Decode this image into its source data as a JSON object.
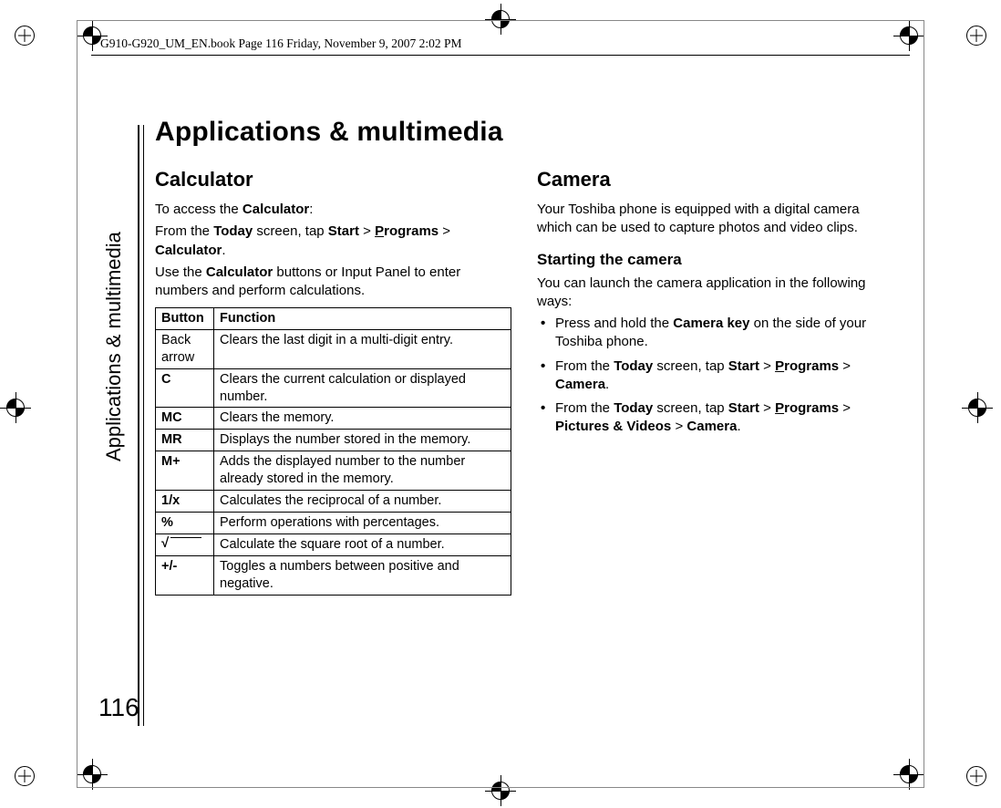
{
  "header": "G910-G920_UM_EN.book  Page 116  Friday, November 9, 2007  2:02 PM",
  "sidebar_label": "Applications & multimedia",
  "page_number": "116",
  "chapter_title": "Applications & multimedia",
  "left": {
    "h1": "Calculator",
    "p1_pre": "To access the ",
    "p1_b": "Calculator",
    "p1_post": ":",
    "p2_a": "From the ",
    "p2_b": "Today",
    "p2_c": " screen, tap ",
    "p2_d": "Start",
    "p2_e": " > ",
    "p2_f_u": "P",
    "p2_f_rest": "rograms",
    "p2_g": " > ",
    "p2_h": "Calculator",
    "p2_i": ".",
    "p3_a": "Use the ",
    "p3_b": "Calculator",
    "p3_c": " buttons or Input Panel to enter numbers and perform calculations.",
    "table": {
      "h_button": "Button",
      "h_function": "Function",
      "rows": [
        {
          "btn": "Back arrow",
          "plain": true,
          "fn": "Clears the last digit in a multi-digit entry."
        },
        {
          "btn": "C",
          "fn": "Clears the current calculation or displayed number."
        },
        {
          "btn": "MC",
          "fn": "Clears the memory."
        },
        {
          "btn": "MR",
          "fn": "Displays the number stored in the memory."
        },
        {
          "btn": "M+",
          "fn": "Adds the displayed number to the number already stored in the memory."
        },
        {
          "btn": "1/x",
          "fn": "Calculates the reciprocal of a number."
        },
        {
          "btn": "%",
          "fn": "Perform operations with percentages."
        },
        {
          "btn": "__SQRT__",
          "fn": "Calculate the square root of a number."
        },
        {
          "btn": "+/-",
          "fn": "Toggles a numbers between positive and negative."
        }
      ]
    }
  },
  "right": {
    "h1": "Camera",
    "p1": "Your Toshiba phone is equipped with a digital camera which can be used to capture photos and video clips.",
    "h2": "Starting the camera",
    "p2": "You can launch the camera application in the following ways:",
    "bullets": {
      "b1_a": "Press and hold the ",
      "b1_b": "Camera key",
      "b1_c": " on the side of your Toshiba phone.",
      "b2_a": "From the ",
      "b2_b": "Today",
      "b2_c": " screen, tap ",
      "b2_d": "Start",
      "b2_e": " > ",
      "b2_f_u": "P",
      "b2_f_rest": "rograms",
      "b2_g": " > ",
      "b2_h": "Camera",
      "b2_i": ".",
      "b3_a": "From the ",
      "b3_b": "Today",
      "b3_c": " screen, tap ",
      "b3_d": "Start",
      "b3_e": " > ",
      "b3_f_u": "P",
      "b3_f_rest": "rograms",
      "b3_g": " > ",
      "b3_h": "Pictures & Videos",
      "b3_i": " > ",
      "b3_j": "Camera",
      "b3_k": "."
    }
  }
}
